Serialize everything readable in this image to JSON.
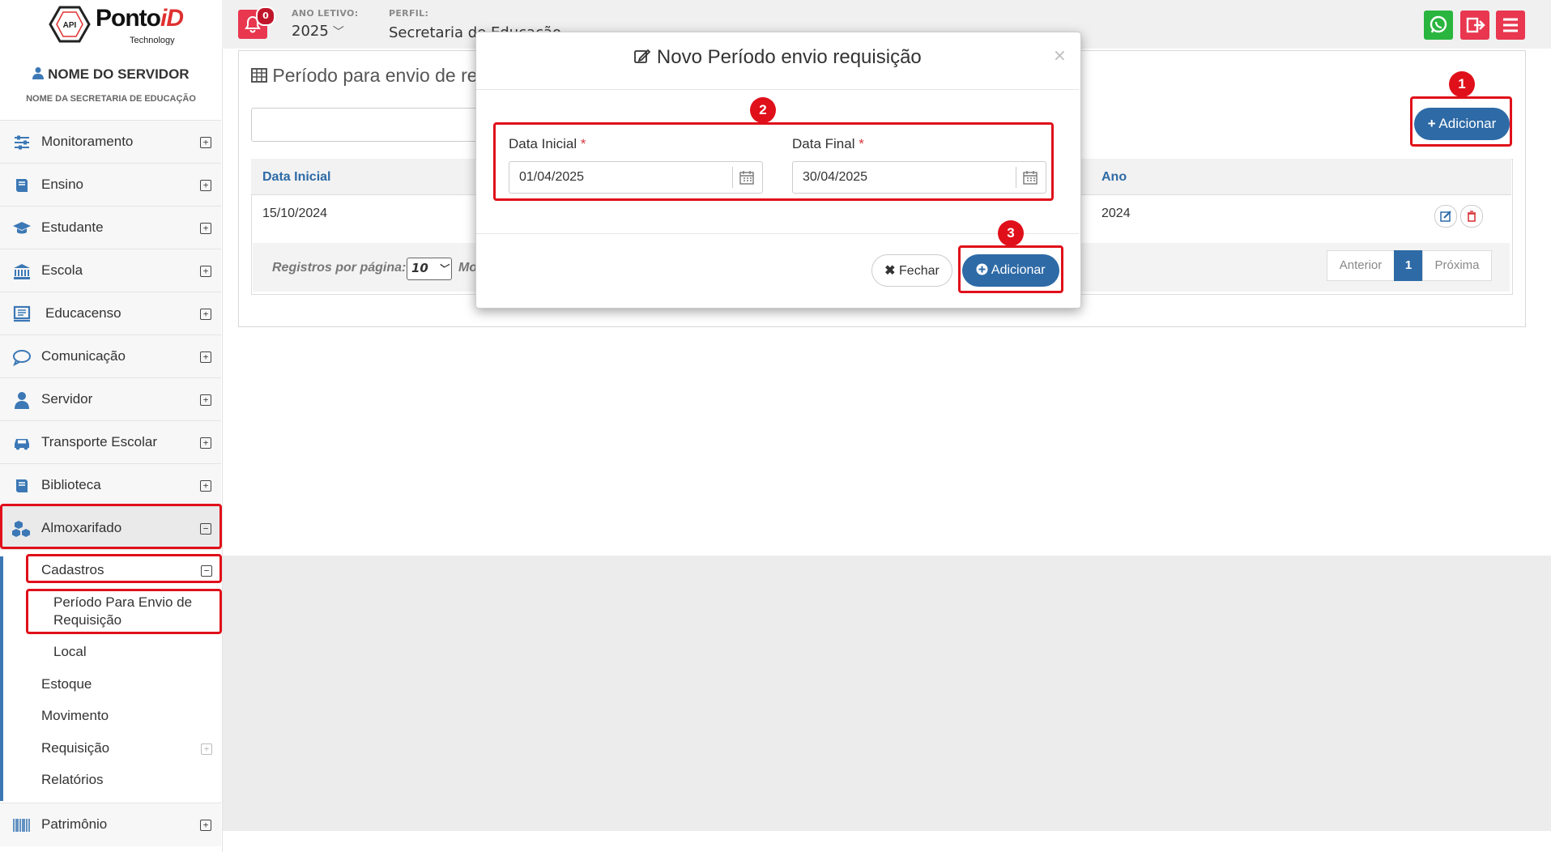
{
  "header": {
    "logo": {
      "brand_main": "Ponto",
      "brand_accent": "iD",
      "brand_sub": "Technology",
      "hex_label": "API"
    },
    "notifications_count": "0",
    "ano_letivo": {
      "label": "ANO LETIVO:",
      "value": "2025"
    },
    "perfil": {
      "label": "PERFIL:",
      "value": "Secretaria de Educação"
    },
    "colors": {
      "whatsapp": "#2ab53f",
      "danger": "#e8374f",
      "primary": "#2d6aa6"
    }
  },
  "sidebar": {
    "user_name": "NOME DO SERVIDOR",
    "secretaria": "NOME DA SECRETARIA DE EDUCAÇÃO",
    "items": [
      {
        "label": "Monitoramento",
        "icon": "sliders-icon"
      },
      {
        "label": "Ensino",
        "icon": "book-icon"
      },
      {
        "label": "Estudante",
        "icon": "graduation-cap-icon"
      },
      {
        "label": "Escola",
        "icon": "institution-icon"
      },
      {
        "label": "Educacenso",
        "icon": "monitor-icon"
      },
      {
        "label": "Comunicação",
        "icon": "chat-bubble-icon"
      },
      {
        "label": "Servidor",
        "icon": "user-icon"
      },
      {
        "label": "Transporte Escolar",
        "icon": "car-icon"
      },
      {
        "label": "Biblioteca",
        "icon": "book-icon"
      },
      {
        "label": "Almoxarifado",
        "icon": "cubes-icon"
      }
    ],
    "submenu": {
      "cadastros": "Cadastros",
      "periodo": "Período Para Envio de Requisição",
      "local": "Local",
      "estoque": "Estoque",
      "movimento": "Movimento",
      "requisicao": "Requisição",
      "relatorios": "Relatórios"
    },
    "patrimonio": {
      "label": "Patrimônio",
      "icon": "barcode-icon"
    }
  },
  "page": {
    "title": "Período para envio de re",
    "add_button": "Adicionar",
    "table": {
      "headers": [
        "Data Inicial",
        "Ano"
      ],
      "rows": [
        {
          "data_inicial": "15/10/2024",
          "ano": "2024"
        }
      ]
    },
    "per_page_label": "Registros por página:",
    "per_page_trail": "Mo",
    "per_page_value": "10",
    "pagination": {
      "prev": "Anterior",
      "current": "1",
      "next": "Próxima"
    }
  },
  "modal": {
    "title": "Novo Período envio requisição",
    "close": "×",
    "fields": {
      "data_inicial": {
        "label": "Data Inicial",
        "value": "01/04/2025"
      },
      "data_final": {
        "label": "Data Final",
        "value": "30/04/2025"
      }
    },
    "required_mark": "*",
    "fechar": "Fechar",
    "adicionar": "Adicionar"
  },
  "annotations": [
    "1",
    "2",
    "3"
  ]
}
